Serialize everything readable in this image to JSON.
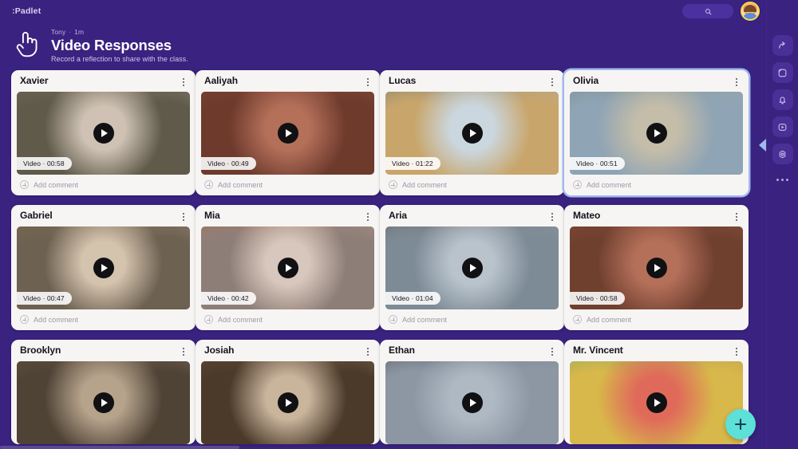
{
  "app": {
    "brand": ":Padlet",
    "background_color": "#3a2280",
    "accent_color": "#5ce0d8",
    "selection_color": "#9fb9ef"
  },
  "topbar": {
    "search_label": "Search",
    "search_icon": "search-icon",
    "avatar_label": "Account"
  },
  "header": {
    "icon": "hand-pointer-icon",
    "author": "Tony",
    "separator": "·",
    "timestamp": "1m",
    "title": "Video Responses",
    "subtitle": "Record a reflection to share with the class."
  },
  "rail": {
    "items": [
      {
        "name": "share-icon",
        "label": "Share"
      },
      {
        "name": "remake-icon",
        "label": "Remake"
      },
      {
        "name": "bell-icon",
        "label": "Notifications"
      },
      {
        "name": "play-icon",
        "label": "Slideshow"
      },
      {
        "name": "gear-icon",
        "label": "Settings"
      }
    ],
    "more_label": "More",
    "collapse_label": "Collapse panel"
  },
  "fab": {
    "label": "Add post",
    "icon": "plus-icon"
  },
  "card_common": {
    "add_comment_label": "Add comment",
    "media_type_label": "Video",
    "separator": "·",
    "menu_label": "Post options",
    "play_label": "Play video"
  },
  "columns": [
    {
      "cards": [
        {
          "name": "Xavier",
          "duration": "00:58",
          "media_label": "Video · 00:58",
          "selected": false,
          "tone_a": "#cfc2b4",
          "tone_b": "#7f6a54",
          "tone_c": "#5f5a4a"
        },
        {
          "name": "Gabriel",
          "duration": "00:47",
          "media_label": "Video · 00:47",
          "selected": false,
          "tone_a": "#d4c3ad",
          "tone_b": "#8a6b4a",
          "tone_c": "#6d6151"
        },
        {
          "name": "Brooklyn",
          "duration": "",
          "media_label": "",
          "selected": false,
          "tone_a": "#b6a38c",
          "tone_b": "#6a5742",
          "tone_c": "#4f4336"
        }
      ]
    },
    {
      "cards": [
        {
          "name": "Aaliyah",
          "duration": "00:49",
          "media_label": "Video · 00:49",
          "selected": false,
          "tone_a": "#b5705a",
          "tone_b": "#8e4b3a",
          "tone_c": "#6d3a2c"
        },
        {
          "name": "Mia",
          "duration": "00:42",
          "media_label": "Video · 00:42",
          "selected": false,
          "tone_a": "#d8c7bc",
          "tone_b": "#b8673a",
          "tone_c": "#8d7e78"
        },
        {
          "name": "Josiah",
          "duration": "",
          "media_label": "",
          "selected": false,
          "tone_a": "#c9b49c",
          "tone_b": "#6d5138",
          "tone_c": "#4b3a2a"
        }
      ]
    },
    {
      "cards": [
        {
          "name": "Lucas",
          "duration": "01:22",
          "media_label": "Video · 01:22",
          "selected": false,
          "tone_a": "#cbd7df",
          "tone_b": "#3b5a77",
          "tone_c": "#c8a56a"
        },
        {
          "name": "Aria",
          "duration": "01:04",
          "media_label": "Video · 01:04",
          "selected": false,
          "tone_a": "#b9c3cc",
          "tone_b": "#5a4a3c",
          "tone_c": "#7d8b96"
        },
        {
          "name": "Ethan",
          "duration": "",
          "media_label": "",
          "selected": false,
          "tone_a": "#aeb9c4",
          "tone_b": "#2c2c33",
          "tone_c": "#8c97a3"
        }
      ]
    },
    {
      "cards": [
        {
          "name": "Olivia",
          "duration": "00:51",
          "media_label": "Video · 00:51",
          "selected": true,
          "tone_a": "#c4bda9",
          "tone_b": "#5b7a6a",
          "tone_c": "#8fa4b5"
        },
        {
          "name": "Mateo",
          "duration": "00:58",
          "media_label": "Video · 00:58",
          "selected": false,
          "tone_a": "#b5705a",
          "tone_b": "#8e4b3a",
          "tone_c": "#70402f"
        },
        {
          "name": "Mr. Vincent",
          "duration": "",
          "media_label": "",
          "selected": false,
          "tone_a": "#e06a5a",
          "tone_b": "#3aa87a",
          "tone_c": "#d8b84a"
        }
      ]
    }
  ]
}
